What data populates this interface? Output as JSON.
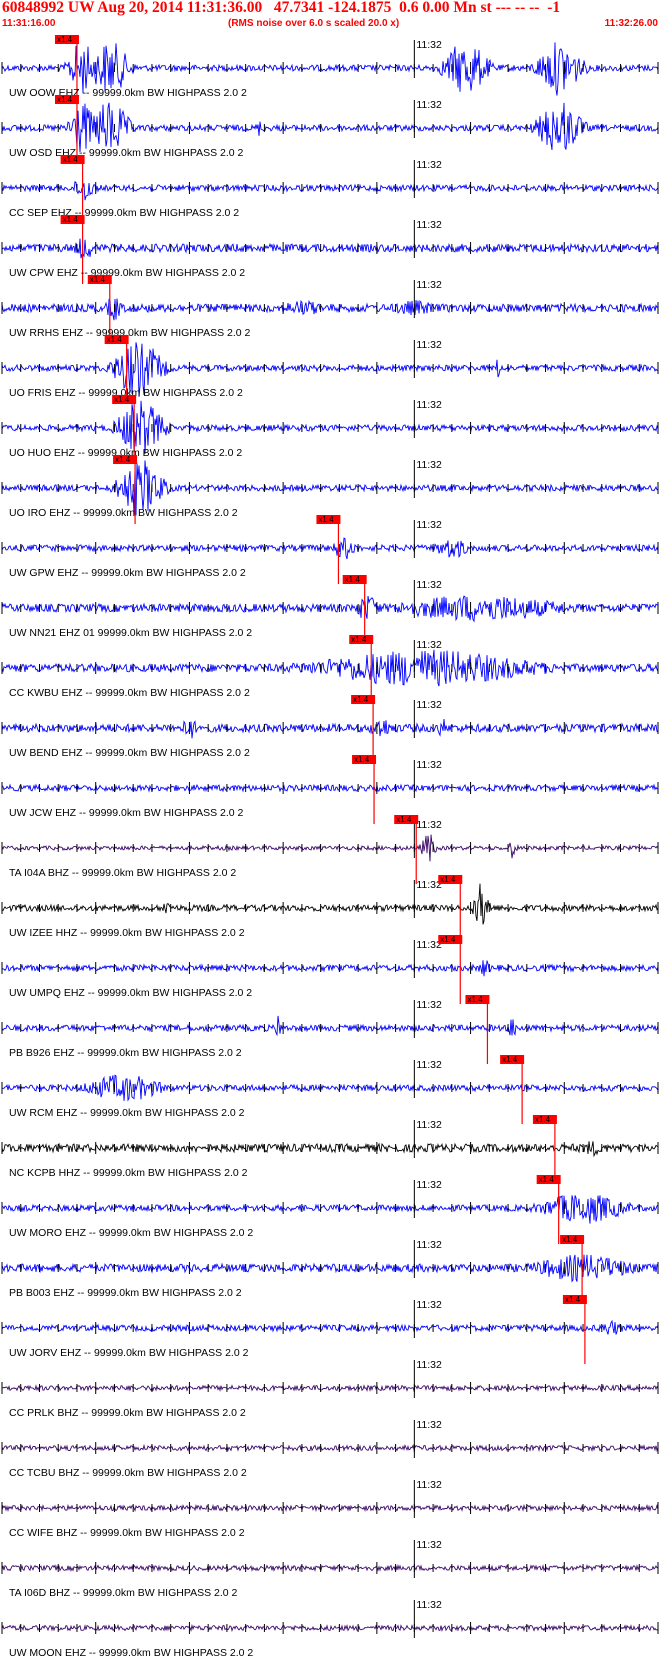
{
  "header": {
    "title": "60848992 UW Aug 20, 2014 11:31:36.00   47.7341 -124.1875  0.6 0.00 Mn st --- -- --  -1",
    "start_time": "11:31:16.00",
    "end_time": "11:32:26.00",
    "note": "(RMS noise over 6.0 s scaled 20.0 x)"
  },
  "colors": {
    "header": "#ff0000",
    "trace_default": "#0000ff",
    "trace_black": "#000000",
    "trace_purple": "#3a0868",
    "pick_marker": "#ff0000",
    "pick_line": "#ff0000"
  },
  "chart_data": {
    "type": "seismogram",
    "x_unit": "seconds after 11:31:16.00",
    "x_range": [
      0,
      70
    ],
    "minute_mark_label": "11:32",
    "minute_mark_time": 44,
    "pick_label": "x1.4",
    "traces": [
      {
        "label": "UW OOW EHZ -- 99999.0km BW  HIGHPASS  2.0  2",
        "pick": 8.0
      },
      {
        "label": "UW OSD EHZ -- 99999.0km BW  HIGHPASS  2.0  2",
        "pick": 8.0
      },
      {
        "label": "CC SEP EHZ -- 99999.0km BW  HIGHPASS  2.0  2",
        "pick": 8.6
      },
      {
        "label": "UW CPW EHZ -- 99999.0km BW  HIGHPASS  2.0  2",
        "pick": 8.6
      },
      {
        "label": "UW RRHS EHZ -- 99999.0km BW  HIGHPASS  2.0  2",
        "pick": 11.5
      },
      {
        "label": "UO FRIS EHZ -- 99999.0km BW  HIGHPASS  2.0  2",
        "pick": 13.3
      },
      {
        "label": "UO HUO EHZ -- 99999.0km BW  HIGHPASS  2.0  2",
        "pick": 14.1
      },
      {
        "label": "UO IRO EHZ -- 99999.0km BW  HIGHPASS  2.0  2",
        "pick": 14.2
      },
      {
        "label": "UW GPW EHZ -- 99999.0km BW  HIGHPASS  2.0  2",
        "pick": 35.9
      },
      {
        "label": "UW NN21 EHZ 01 99999.0km BW  HIGHPASS  2.0  2",
        "pick": 38.7
      },
      {
        "label": "CC KWBU EHZ -- 99999.0km BW  HIGHPASS  2.0  2",
        "pick": 39.4
      },
      {
        "label": "UW BEND EHZ -- 99999.0km BW  HIGHPASS  2.0  2",
        "pick": 39.6
      },
      {
        "label": "UW JCW EHZ -- 99999.0km BW  HIGHPASS  2.0  2",
        "pick": 39.7
      },
      {
        "label": "TA I04A BHZ -- 99999.0km BW  HIGHPASS  2.0  2",
        "pick": 44.2
      },
      {
        "label": "UW IZEE HHZ -- 99999.0km BW  HIGHPASS  2.0  2",
        "pick": 48.9
      },
      {
        "label": "UW UMPQ EHZ -- 99999.0km BW  HIGHPASS  2.0  2",
        "pick": 48.9
      },
      {
        "label": "PB B926 EHZ -- 99999.0km BW  HIGHPASS  2.0  2",
        "pick": 51.8
      },
      {
        "label": "UW RCM EHZ -- 99999.0km BW  HIGHPASS  2.0  2",
        "pick": 55.5
      },
      {
        "label": "NC KCPB HHZ -- 99999.0km BW  HIGHPASS  2.0  2",
        "pick": 59.0
      },
      {
        "label": "UW MORO EHZ -- 99999.0km BW  HIGHPASS  2.0  2",
        "pick": 59.4
      },
      {
        "label": "PB B003 EHZ -- 99999.0km BW  HIGHPASS  2.0  2",
        "pick": 61.9
      },
      {
        "label": "UW JORV EHZ -- 99999.0km BW  HIGHPASS  2.0  2",
        "pick": 62.2
      },
      {
        "label": "CC PRLK BHZ -- 99999.0km BW  HIGHPASS  2.0  2",
        "pick": null
      },
      {
        "label": "CC TCBU BHZ -- 99999.0km BW  HIGHPASS  2.0  2",
        "pick": null
      },
      {
        "label": "CC WIFE BHZ -- 99999.0km BW  HIGHPASS  2.0  2",
        "pick": null
      },
      {
        "label": "TA I06D BHZ -- 99999.0km BW  HIGHPASS  2.0  2",
        "pick": null
      },
      {
        "label": "UW MOON EHZ -- 99999.0km BW  HIGHPASS  2.0  2",
        "pick": null
      }
    ]
  }
}
